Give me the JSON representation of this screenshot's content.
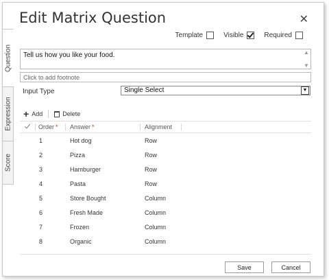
{
  "dialog": {
    "title": "Edit Matrix Question",
    "close_glyph": "✕"
  },
  "side_tabs": [
    {
      "label": "Question",
      "active": true
    },
    {
      "label": "Expression",
      "active": false
    },
    {
      "label": "Score",
      "active": false
    }
  ],
  "options": {
    "template": {
      "label": "Template",
      "checked": false
    },
    "visible": {
      "label": "Visible",
      "checked": true
    },
    "required": {
      "label": "Required",
      "checked": false
    }
  },
  "question": {
    "text": "Tell us how you like your food.",
    "footnote_placeholder": "Click to add footnote"
  },
  "input_type": {
    "label": "Input Type",
    "selected": "Single Select"
  },
  "toolbar": {
    "add_label": "Add",
    "delete_label": "Delete",
    "add_icon": "plus-icon",
    "delete_icon": "trash-icon"
  },
  "grid": {
    "headers": {
      "order": "Order",
      "answer": "Answer",
      "alignment": "Alignment",
      "required_mark": "*"
    },
    "rows": [
      {
        "order": "1",
        "answer": "Hot dog",
        "alignment": "Row"
      },
      {
        "order": "2",
        "answer": "Pizza",
        "alignment": "Row"
      },
      {
        "order": "3",
        "answer": "Hamburger",
        "alignment": "Row"
      },
      {
        "order": "4",
        "answer": "Pasta",
        "alignment": "Row"
      },
      {
        "order": "5",
        "answer": "Store Bought",
        "alignment": "Column"
      },
      {
        "order": "6",
        "answer": "Fresh Made",
        "alignment": "Column"
      },
      {
        "order": "7",
        "answer": "Frozen",
        "alignment": "Column"
      },
      {
        "order": "8",
        "answer": "Organic",
        "alignment": "Column"
      }
    ]
  },
  "footer": {
    "save_label": "Save",
    "cancel_label": "Cancel"
  },
  "colors": {
    "required_asterisk": "#d9262a",
    "border": "#b9b9b9"
  }
}
